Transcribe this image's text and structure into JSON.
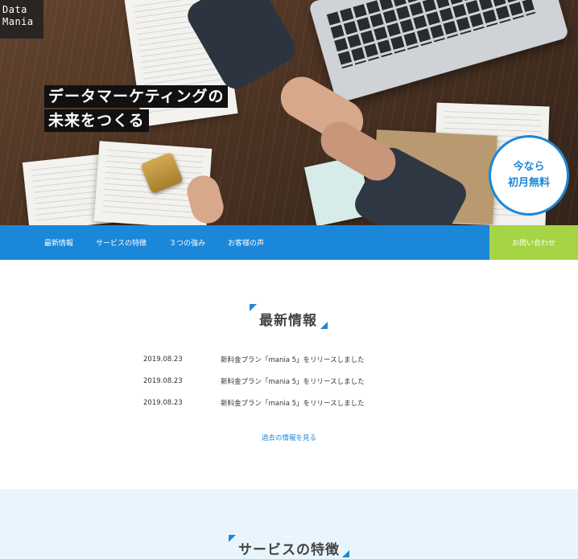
{
  "logo": {
    "line1": "Data",
    "line2": "Mania"
  },
  "hero": {
    "catch_line1": "データマーケティングの",
    "catch_line2": "未来をつくる",
    "badge_line1": "今なら",
    "badge_line2": "初月無料"
  },
  "nav": {
    "items": [
      {
        "label": "最新情報"
      },
      {
        "label": "サービスの特徴"
      },
      {
        "label": "３つの強み"
      },
      {
        "label": "お客様の声"
      }
    ],
    "contact_label": "お問い合わせ"
  },
  "news": {
    "title": "最新情報",
    "rows": [
      {
        "date": "2019.08.23",
        "text": "新料金プラン「mania 5」をリリースしました"
      },
      {
        "date": "2019.08.23",
        "text": "新料金プラン「mania 5」をリリースしました"
      },
      {
        "date": "2019.08.23",
        "text": "新料金プラン「mania 5」をリリースしました"
      }
    ],
    "more_label": "過去の情報を見る"
  },
  "service": {
    "title": "サービスの特徴"
  },
  "colors": {
    "accent": "#1b87d8",
    "contact": "#a6d445",
    "service_bg": "#e9f5fc"
  }
}
